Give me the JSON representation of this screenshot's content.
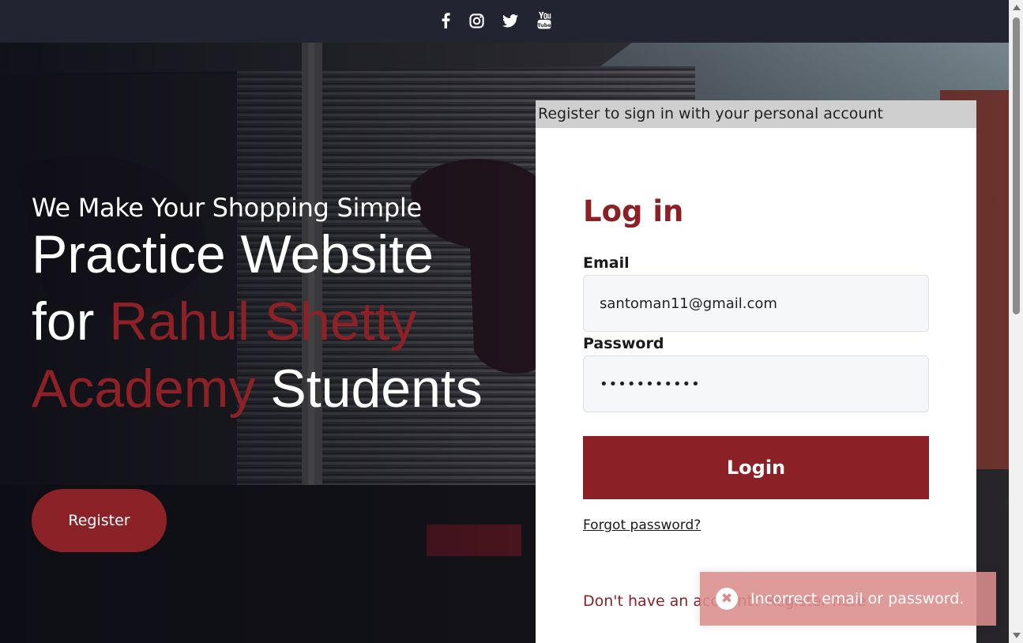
{
  "social_icons": [
    "facebook-icon",
    "instagram-icon",
    "twitter-icon",
    "youtube-icon"
  ],
  "hero": {
    "tagline": "We Make Your Shopping Simple",
    "headline_lead": "Practice Website for",
    "headline_accent": "Rahul Shetty Academy",
    "headline_tail": "Students",
    "register_label": "Register"
  },
  "card": {
    "banner": "Register to sign in with your personal account",
    "title": "Log in",
    "email_label": "Email",
    "email_value": "santoman11@gmail.com",
    "password_label": "Password",
    "password_value": "•••••••••••",
    "login_label": "Login",
    "forgot_label": "Forgot password?",
    "no_account_label": "Don't have an account? Register here"
  },
  "toast": {
    "message": "Incorrect email or password.",
    "icon": "error-x-icon"
  },
  "colors": {
    "accent": "#8b2126",
    "topbar": "#222431",
    "toast": "#db8c8c"
  }
}
